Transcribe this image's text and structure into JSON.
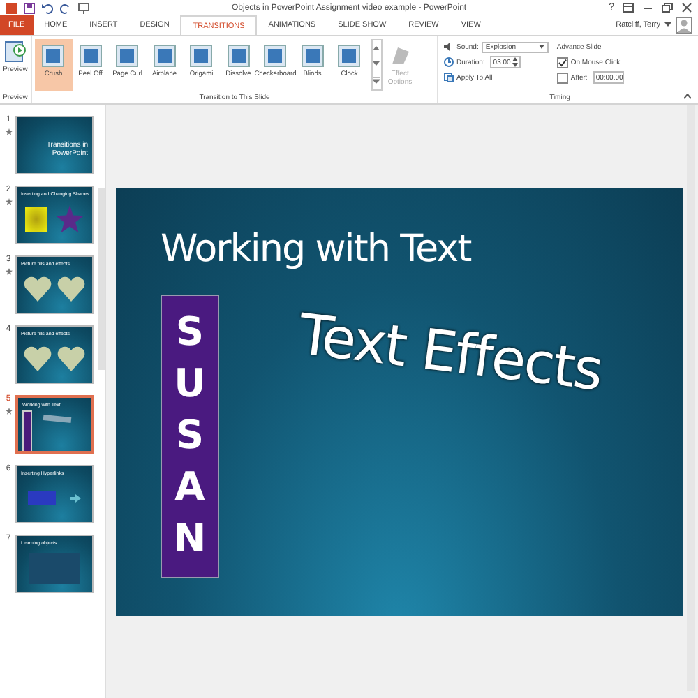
{
  "window": {
    "title": "Objects in PowerPoint Assignment video example - PowerPoint",
    "user": "Ratcliff, Terry",
    "help": "?"
  },
  "tabs": [
    {
      "label": "FILE",
      "kind": "file",
      "selected": false
    },
    {
      "label": "HOME",
      "kind": "tab",
      "selected": false
    },
    {
      "label": "INSERT",
      "kind": "tab",
      "selected": false
    },
    {
      "label": "DESIGN",
      "kind": "tab",
      "selected": false
    },
    {
      "label": "TRANSITIONS",
      "kind": "tab",
      "selected": true
    },
    {
      "label": "ANIMATIONS",
      "kind": "tab",
      "selected": false
    },
    {
      "label": "SLIDE SHOW",
      "kind": "tab",
      "selected": false
    },
    {
      "label": "REVIEW",
      "kind": "tab",
      "selected": false
    },
    {
      "label": "VIEW",
      "kind": "tab",
      "selected": false
    }
  ],
  "ribbon": {
    "preview": {
      "label": "Preview",
      "group": "Preview"
    },
    "transitions": {
      "group": "Transition to This Slide",
      "items": [
        {
          "label": "Crush",
          "selected": true
        },
        {
          "label": "Peel Off",
          "selected": false
        },
        {
          "label": "Page Curl",
          "selected": false
        },
        {
          "label": "Airplane",
          "selected": false
        },
        {
          "label": "Origami",
          "selected": false
        },
        {
          "label": "Dissolve",
          "selected": false
        },
        {
          "label": "Checkerboard",
          "selected": false
        },
        {
          "label": "Blinds",
          "selected": false
        },
        {
          "label": "Clock",
          "selected": false
        }
      ]
    },
    "effect_options": {
      "label": "Effect Options",
      "disabled": true
    },
    "timing": {
      "group": "Timing",
      "sound_label": "Sound:",
      "sound": "Explosion",
      "duration_label": "Duration:",
      "duration": "03.00",
      "apply_all": "Apply To All",
      "advance_title": "Advance Slide",
      "on_click": {
        "label": "On Mouse Click",
        "checked": true
      },
      "after": {
        "label": "After:",
        "checked": false,
        "value": "00:00.00"
      }
    }
  },
  "slides": [
    {
      "number": "1",
      "selected": false,
      "animated": true,
      "kind": "title",
      "title": "Transitions in PowerPoint"
    },
    {
      "number": "2",
      "selected": false,
      "animated": true,
      "kind": "shapes",
      "title": "Inserting and Changing Shapes"
    },
    {
      "number": "3",
      "selected": false,
      "animated": true,
      "kind": "hearts",
      "title": "Picture fills and effects"
    },
    {
      "number": "4",
      "selected": false,
      "animated": false,
      "kind": "hearts",
      "title": "Picture fills and effects"
    },
    {
      "number": "5",
      "selected": true,
      "animated": true,
      "kind": "text",
      "title": "Working with Text"
    },
    {
      "number": "6",
      "selected": false,
      "animated": false,
      "kind": "links",
      "title": "Inserting Hyperlinks"
    },
    {
      "number": "7",
      "selected": false,
      "animated": false,
      "kind": "photo",
      "title": "Learning objects"
    }
  ],
  "current_slide": {
    "title": "Working with Text",
    "vertical_text": "SUSAN",
    "wordart": "Text Effects"
  }
}
